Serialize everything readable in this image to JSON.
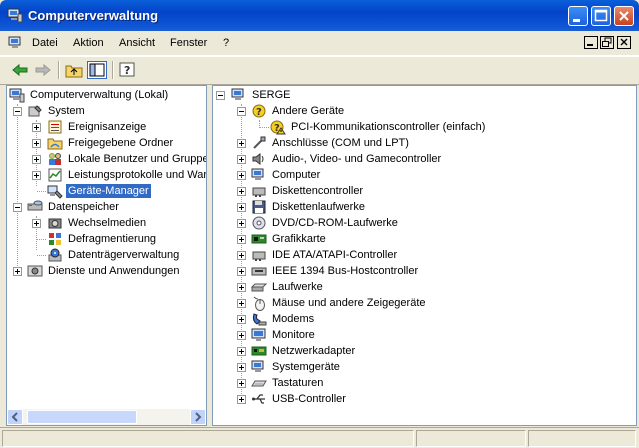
{
  "window": {
    "title": "Computerverwaltung"
  },
  "menu": {
    "items": [
      "Datei",
      "Aktion",
      "Ansicht",
      "Fenster",
      "?"
    ]
  },
  "toolbar": {
    "buttons": [
      "back-arrow-icon",
      "forward-arrow-icon",
      "up-folder-icon",
      "show-hide-tree-icon",
      "help-icon"
    ]
  },
  "left_tree": {
    "root": "Computerverwaltung (Lokal)",
    "system": "System",
    "system_children": [
      "Ereignisanzeige",
      "Freigegebene Ordner",
      "Lokale Benutzer und Gruppen",
      "Leistungsprotokolle und Warnungen",
      "Geräte-Manager"
    ],
    "storage": "Datenspeicher",
    "storage_children": [
      "Wechselmedien",
      "Defragmentierung",
      "Datenträgerverwaltung"
    ],
    "services": "Dienste und Anwendungen",
    "selected": "Geräte-Manager"
  },
  "right_tree": {
    "root": "SERGE",
    "other_devices": "Andere Geräte",
    "other_child": "PCI-Kommunikationscontroller (einfach)",
    "categories": [
      "Anschlüsse (COM und LPT)",
      "Audio-, Video- und Gamecontroller",
      "Computer",
      "Diskettencontroller",
      "Diskettenlaufwerke",
      "DVD/CD-ROM-Laufwerke",
      "Grafikkarte",
      "IDE ATA/ATAPI-Controller",
      "IEEE 1394 Bus-Hostcontroller",
      "Laufwerke",
      "Mäuse und andere Zeigegeräte",
      "Modems",
      "Monitore",
      "Netzwerkadapter",
      "Systemgeräte",
      "Tastaturen",
      "USB-Controller"
    ]
  }
}
